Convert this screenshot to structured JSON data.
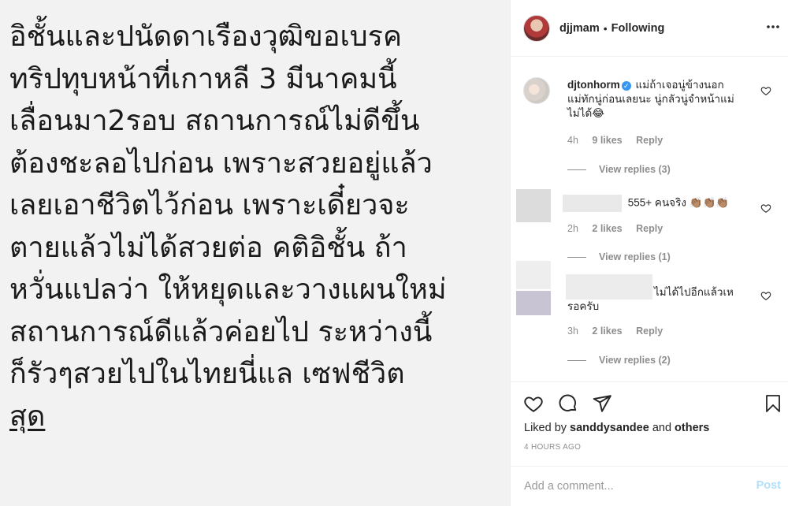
{
  "post_text": {
    "lines": [
      "อิชั้นและปนัดดาเรืองวุฒิขอเบรค",
      "ทริปทุบหน้าที่เกาหลี 3 มีนาคมนี้",
      "เลื่อนมา2รอบ สถานการณ์ไม่ดีขึ้น",
      "ต้องชะลอไปก่อน  เพราะสวยอยู่แล้ว",
      "เลยเอาชีวิตไว้ก่อน  เพราะเดี๋ยวจะ",
      "ตายแล้วไม่ได้สวยต่อ คติอิชั้น  ถ้า",
      "หวั่นแปลว่า ให้หยุดและวางแผนใหม่",
      "สถานการณ์ดีแล้วค่อยไป  ระหว่างนี้",
      "ก็รัวๆสวยไปในไทยนี่แล  เซฟชีวิต",
      "สุด"
    ]
  },
  "header": {
    "username": "djjmam",
    "separator": "•",
    "follow_status": "Following"
  },
  "comments": [
    {
      "username": "djtonhorm",
      "verified": true,
      "text_line1": "แม่ถ้าเจอนู่ข้างนอก",
      "text_line2": "แม่ทักนู่ก่อนเลยนะ นู่กลัวนู่จำหน้าแม่",
      "text_line3": "ไม่ได้😂",
      "time": "4h",
      "likes": "9 likes",
      "reply": "Reply",
      "view_replies": "View replies (3)"
    },
    {
      "text": "555+ คนจริง 👏🏽👏🏽👏🏽",
      "time": "2h",
      "likes": "2 likes",
      "reply": "Reply",
      "view_replies": "View replies (1)"
    },
    {
      "text_line1": "ไม่ได้ไปอีกแล้วเห",
      "text_line2": "รอครับ",
      "time": "3h",
      "likes": "2 likes",
      "reply": "Reply",
      "view_replies": "View replies (2)"
    }
  ],
  "footer": {
    "liked_prefix": "Liked by ",
    "liked_user": "sanddysandee",
    "liked_and": " and ",
    "liked_others": "others",
    "time_ago": "4 HOURS AGO",
    "add_comment_placeholder": "Add a comment...",
    "post_label": "Post"
  },
  "icons": [
    "more-icon",
    "heart-icon",
    "comment-icon",
    "share-icon",
    "bookmark-icon",
    "verified-icon",
    "small-heart-icon"
  ]
}
